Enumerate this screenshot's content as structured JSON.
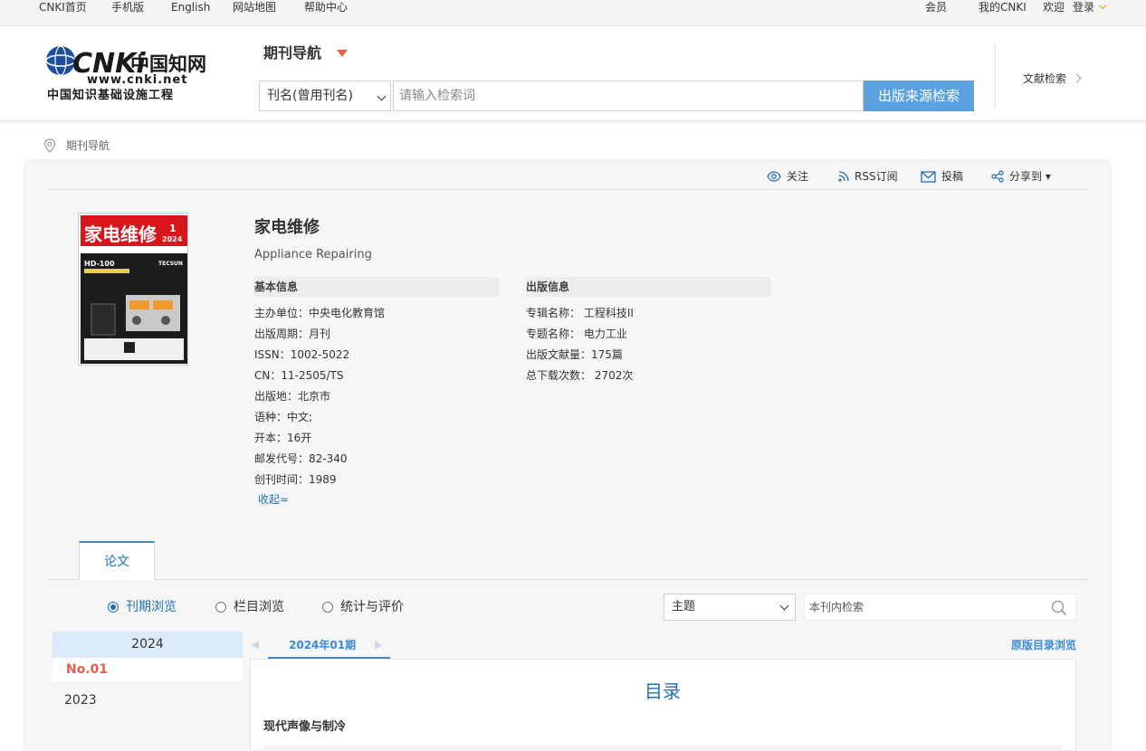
{
  "topbar": {
    "links": [
      "CNKI首页",
      "手机版",
      "English",
      "网站地图",
      "帮助中心"
    ],
    "right": [
      "会员",
      "我的CNKI",
      "欢迎",
      "登录"
    ]
  },
  "header": {
    "logo": {
      "cnki": "CNKi",
      "chinese": "中国知网",
      "url": "www.cnki.net",
      "slogan": "中国知识基础设施工程"
    },
    "nav_title": "期刊导航",
    "search_field": "刊名(曾用刊名)",
    "search_placeholder": "请输入检索词",
    "search_button": "出版来源检索",
    "doc_search": "文献检索"
  },
  "breadcrumb": "期刊导航",
  "actions": {
    "follow": "关注",
    "rss": "RSS订阅",
    "submit": "投稿",
    "share": "分享到 ▾"
  },
  "journal": {
    "title": "家电维修",
    "subtitle": "Appliance Repairing",
    "cover": {
      "name": "家电维修",
      "issue": "1",
      "year": "2024",
      "product": "HD-100",
      "brand": "TECSUN"
    },
    "basic_head": "基本信息",
    "basic": [
      "主办单位：中央电化教育馆",
      "出版周期：月刊",
      "ISSN：1002-5022",
      "CN：11-2505/TS",
      "出版地：北京市",
      "语种：中文;",
      "开本：16开",
      "邮发代号：82-340",
      "创刊时间：1989"
    ],
    "pub_head": "出版信息",
    "pub": [
      "专辑名称：  工程科技II",
      "专题名称：  电力工业",
      "出版文献量：175篇",
      "总下载次数：  2702次"
    ],
    "collapse": "收起≈"
  },
  "tabs": {
    "papers": "论文"
  },
  "browse": {
    "options": [
      "刊期浏览",
      "栏目浏览",
      "统计与评价"
    ],
    "field": "主题",
    "inner_search": "本刊内检索"
  },
  "years": {
    "selected_year": "2024",
    "selected_issue": "No.01",
    "other_year": "2023"
  },
  "issue": {
    "label": "2024年01期",
    "original_toc": "原版目录浏览",
    "toc_title": "目录",
    "section": "现代声像与制冷"
  }
}
